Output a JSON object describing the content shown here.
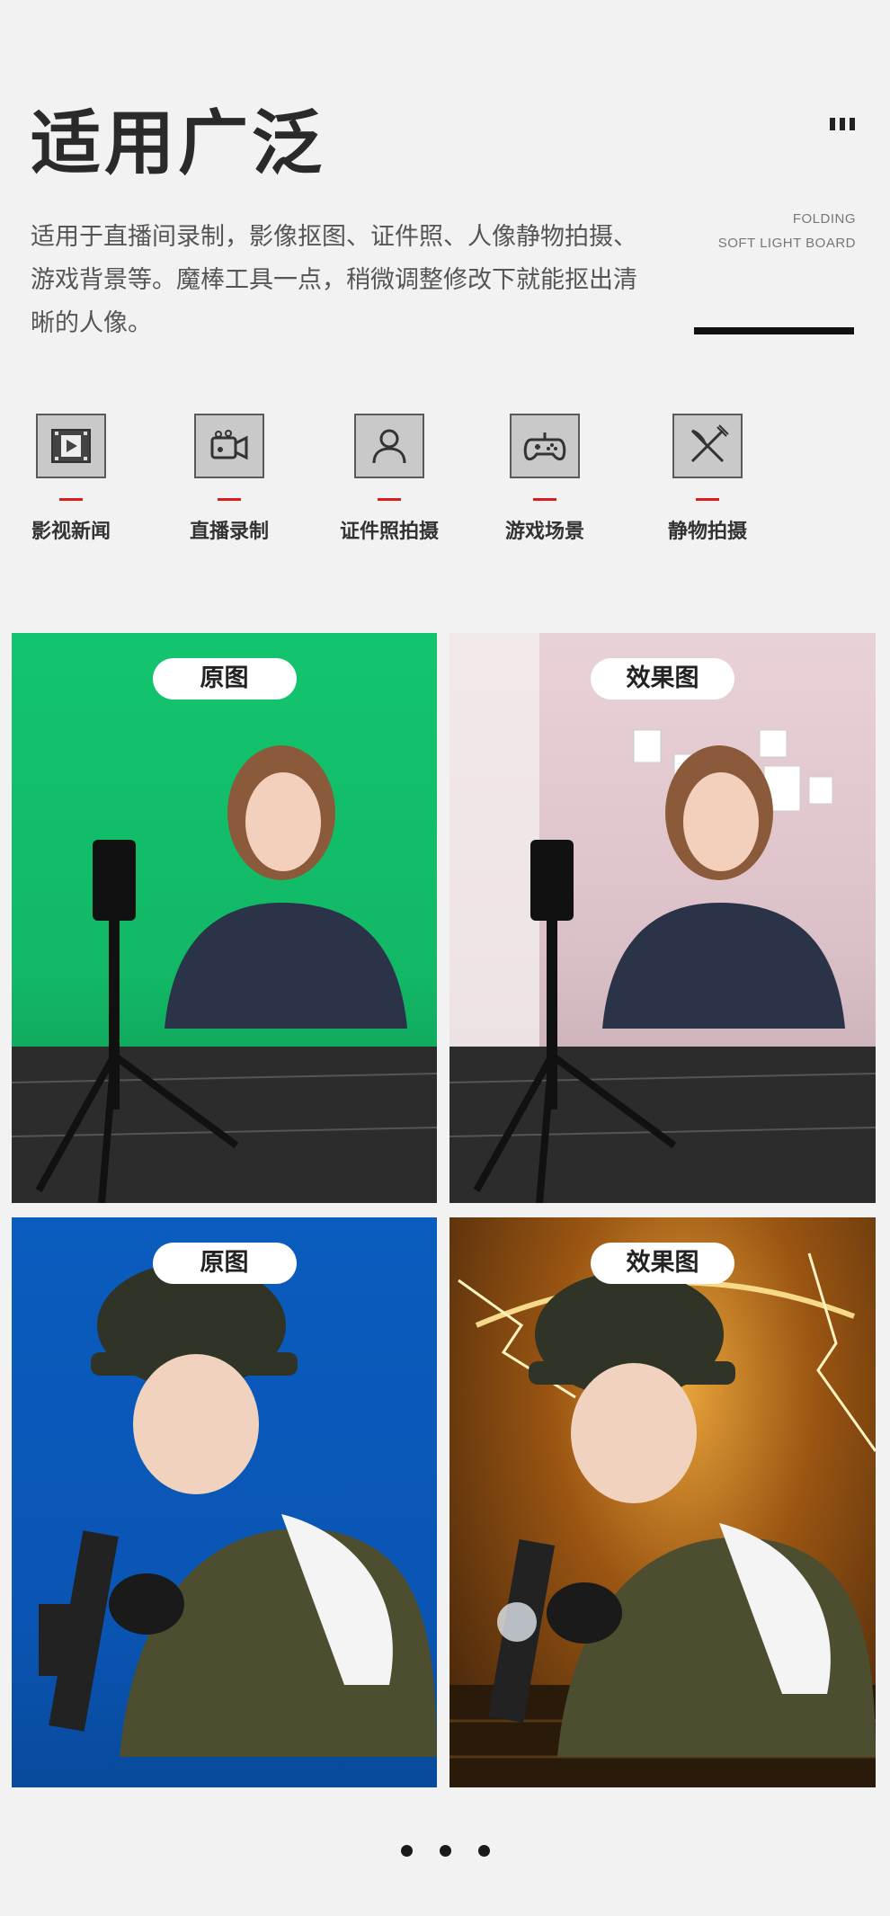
{
  "header": {
    "title": "适用广泛",
    "description": "适用于直播间录制，影像抠图、证件照、人像静物拍摄、游戏背景等。魔棒工具一点，稍微调整修改下就能抠出清晰的人像。",
    "english_line1": "FOLDING",
    "english_line2": "SOFT LIGHT BOARD"
  },
  "categories": [
    {
      "label": "影视新闻",
      "icon": "film-icon"
    },
    {
      "label": "直播录制",
      "icon": "video-camera-icon"
    },
    {
      "label": "证件照拍摄",
      "icon": "person-icon"
    },
    {
      "label": "游戏场景",
      "icon": "gamepad-icon"
    },
    {
      "label": "静物拍摄",
      "icon": "fork-knife-icon"
    }
  ],
  "comparisons": {
    "original_label": "原图",
    "effect_label": "效果图"
  },
  "colors": {
    "accent_red": "#d81e1e",
    "green_screen": "#13c46e",
    "blue_screen": "#0a5cbe"
  },
  "pagination": {
    "count": 3
  }
}
